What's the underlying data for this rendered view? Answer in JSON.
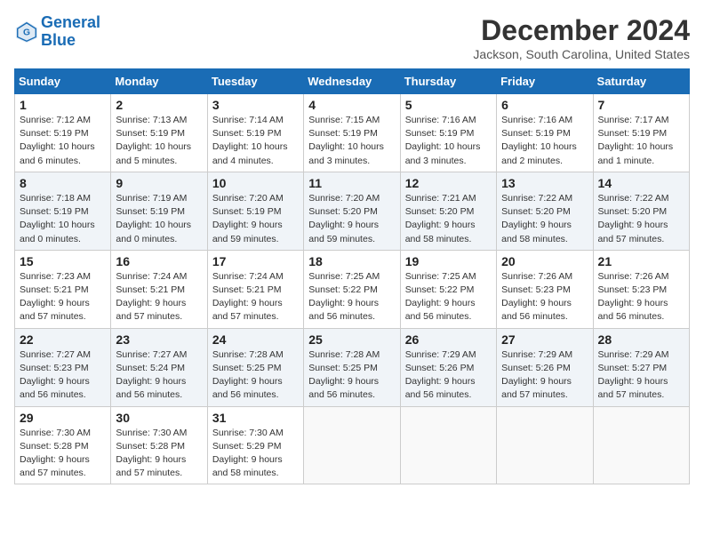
{
  "header": {
    "logo_line1": "General",
    "logo_line2": "Blue",
    "month_title": "December 2024",
    "location": "Jackson, South Carolina, United States"
  },
  "weekdays": [
    "Sunday",
    "Monday",
    "Tuesday",
    "Wednesday",
    "Thursday",
    "Friday",
    "Saturday"
  ],
  "days": [
    null,
    null,
    {
      "num": "1",
      "sunrise": "Sunrise: 7:12 AM",
      "sunset": "Sunset: 5:19 PM",
      "daylight": "Daylight: 10 hours and 6 minutes."
    },
    {
      "num": "2",
      "sunrise": "Sunrise: 7:13 AM",
      "sunset": "Sunset: 5:19 PM",
      "daylight": "Daylight: 10 hours and 5 minutes."
    },
    {
      "num": "3",
      "sunrise": "Sunrise: 7:14 AM",
      "sunset": "Sunset: 5:19 PM",
      "daylight": "Daylight: 10 hours and 4 minutes."
    },
    {
      "num": "4",
      "sunrise": "Sunrise: 7:15 AM",
      "sunset": "Sunset: 5:19 PM",
      "daylight": "Daylight: 10 hours and 3 minutes."
    },
    {
      "num": "5",
      "sunrise": "Sunrise: 7:16 AM",
      "sunset": "Sunset: 5:19 PM",
      "daylight": "Daylight: 10 hours and 3 minutes."
    },
    {
      "num": "6",
      "sunrise": "Sunrise: 7:16 AM",
      "sunset": "Sunset: 5:19 PM",
      "daylight": "Daylight: 10 hours and 2 minutes."
    },
    {
      "num": "7",
      "sunrise": "Sunrise: 7:17 AM",
      "sunset": "Sunset: 5:19 PM",
      "daylight": "Daylight: 10 hours and 1 minute."
    },
    {
      "num": "8",
      "sunrise": "Sunrise: 7:18 AM",
      "sunset": "Sunset: 5:19 PM",
      "daylight": "Daylight: 10 hours and 0 minutes."
    },
    {
      "num": "9",
      "sunrise": "Sunrise: 7:19 AM",
      "sunset": "Sunset: 5:19 PM",
      "daylight": "Daylight: 10 hours and 0 minutes."
    },
    {
      "num": "10",
      "sunrise": "Sunrise: 7:20 AM",
      "sunset": "Sunset: 5:19 PM",
      "daylight": "Daylight: 9 hours and 59 minutes."
    },
    {
      "num": "11",
      "sunrise": "Sunrise: 7:20 AM",
      "sunset": "Sunset: 5:20 PM",
      "daylight": "Daylight: 9 hours and 59 minutes."
    },
    {
      "num": "12",
      "sunrise": "Sunrise: 7:21 AM",
      "sunset": "Sunset: 5:20 PM",
      "daylight": "Daylight: 9 hours and 58 minutes."
    },
    {
      "num": "13",
      "sunrise": "Sunrise: 7:22 AM",
      "sunset": "Sunset: 5:20 PM",
      "daylight": "Daylight: 9 hours and 58 minutes."
    },
    {
      "num": "14",
      "sunrise": "Sunrise: 7:22 AM",
      "sunset": "Sunset: 5:20 PM",
      "daylight": "Daylight: 9 hours and 57 minutes."
    },
    {
      "num": "15",
      "sunrise": "Sunrise: 7:23 AM",
      "sunset": "Sunset: 5:21 PM",
      "daylight": "Daylight: 9 hours and 57 minutes."
    },
    {
      "num": "16",
      "sunrise": "Sunrise: 7:24 AM",
      "sunset": "Sunset: 5:21 PM",
      "daylight": "Daylight: 9 hours and 57 minutes."
    },
    {
      "num": "17",
      "sunrise": "Sunrise: 7:24 AM",
      "sunset": "Sunset: 5:21 PM",
      "daylight": "Daylight: 9 hours and 57 minutes."
    },
    {
      "num": "18",
      "sunrise": "Sunrise: 7:25 AM",
      "sunset": "Sunset: 5:22 PM",
      "daylight": "Daylight: 9 hours and 56 minutes."
    },
    {
      "num": "19",
      "sunrise": "Sunrise: 7:25 AM",
      "sunset": "Sunset: 5:22 PM",
      "daylight": "Daylight: 9 hours and 56 minutes."
    },
    {
      "num": "20",
      "sunrise": "Sunrise: 7:26 AM",
      "sunset": "Sunset: 5:23 PM",
      "daylight": "Daylight: 9 hours and 56 minutes."
    },
    {
      "num": "21",
      "sunrise": "Sunrise: 7:26 AM",
      "sunset": "Sunset: 5:23 PM",
      "daylight": "Daylight: 9 hours and 56 minutes."
    },
    {
      "num": "22",
      "sunrise": "Sunrise: 7:27 AM",
      "sunset": "Sunset: 5:23 PM",
      "daylight": "Daylight: 9 hours and 56 minutes."
    },
    {
      "num": "23",
      "sunrise": "Sunrise: 7:27 AM",
      "sunset": "Sunset: 5:24 PM",
      "daylight": "Daylight: 9 hours and 56 minutes."
    },
    {
      "num": "24",
      "sunrise": "Sunrise: 7:28 AM",
      "sunset": "Sunset: 5:25 PM",
      "daylight": "Daylight: 9 hours and 56 minutes."
    },
    {
      "num": "25",
      "sunrise": "Sunrise: 7:28 AM",
      "sunset": "Sunset: 5:25 PM",
      "daylight": "Daylight: 9 hours and 56 minutes."
    },
    {
      "num": "26",
      "sunrise": "Sunrise: 7:29 AM",
      "sunset": "Sunset: 5:26 PM",
      "daylight": "Daylight: 9 hours and 56 minutes."
    },
    {
      "num": "27",
      "sunrise": "Sunrise: 7:29 AM",
      "sunset": "Sunset: 5:26 PM",
      "daylight": "Daylight: 9 hours and 57 minutes."
    },
    {
      "num": "28",
      "sunrise": "Sunrise: 7:29 AM",
      "sunset": "Sunset: 5:27 PM",
      "daylight": "Daylight: 9 hours and 57 minutes."
    },
    {
      "num": "29",
      "sunrise": "Sunrise: 7:30 AM",
      "sunset": "Sunset: 5:28 PM",
      "daylight": "Daylight: 9 hours and 57 minutes."
    },
    {
      "num": "30",
      "sunrise": "Sunrise: 7:30 AM",
      "sunset": "Sunset: 5:28 PM",
      "daylight": "Daylight: 9 hours and 57 minutes."
    },
    {
      "num": "31",
      "sunrise": "Sunrise: 7:30 AM",
      "sunset": "Sunset: 5:29 PM",
      "daylight": "Daylight: 9 hours and 58 minutes."
    }
  ]
}
